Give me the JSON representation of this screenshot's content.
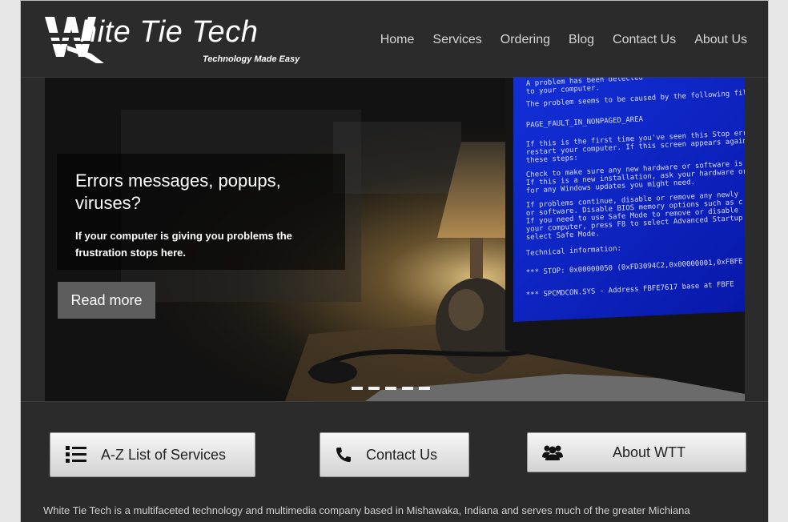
{
  "header": {
    "logo_text": "hite Tie Tech",
    "logo_tagline": "Technology Made Easy",
    "nav": [
      "Home",
      "Services",
      "Ordering",
      "Blog",
      "Contact Us",
      "About Us"
    ]
  },
  "hero": {
    "title": "Errors messages, popups, viruses?",
    "text": "If your computer is giving you problems the frustration stops here.",
    "button_label": "Read more",
    "screen_lines": [
      "A problem has been detected",
      "to your computer.",
      "The problem seems to be caused by the following file",
      "PAGE_FAULT_IN_NONPAGED_AREA",
      "If this is the first time you've seen this Stop err",
      "restart your computer. If this screen appears again",
      "these steps:",
      "Check to make sure any new hardware or software is",
      "If this is a new installation, ask your hardware or",
      "for any Windows updates you might need.",
      "If problems continue, disable or remove any newly",
      "or software. Disable BIOS memory options such as c",
      "If you need to use Safe Mode to remove or disable",
      "your computer, press F8 to select Advanced Startup",
      "select Safe Mode.",
      "Technical information:",
      "*** STOP: 0x00000050 (0xFD3094C2,0x00000001,0xFBFE",
      "*** SPCMDCON.SYS - Address FBFE7617 base at FBFE"
    ],
    "slides": 5
  },
  "ctas": {
    "services": "A-Z List of Services",
    "contact": "Contact Us",
    "about": "About WTT"
  },
  "about_text": "White Tie Tech is a multifaceted technology and multimedia company based in Mishawaka, Indiana and serves much of the greater Michiana"
}
